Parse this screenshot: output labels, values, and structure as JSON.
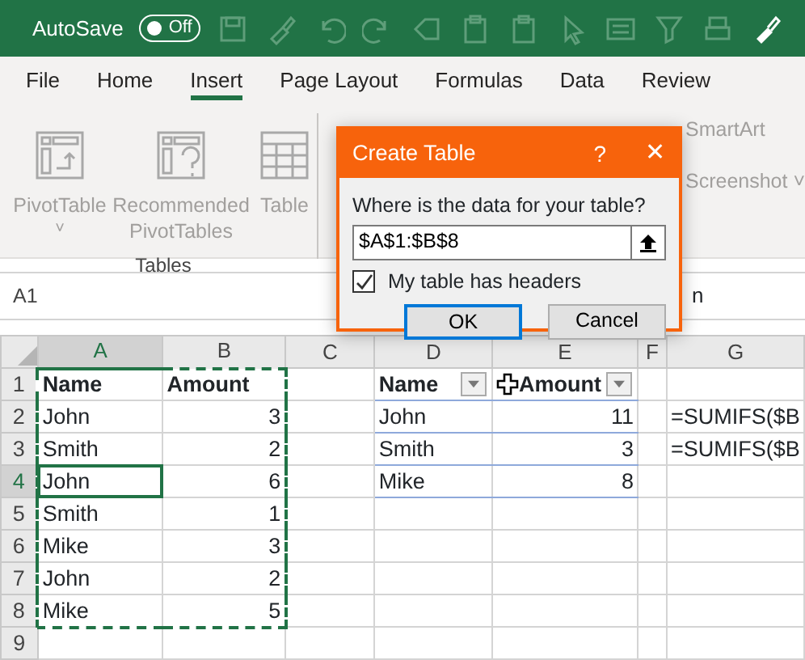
{
  "title_bar": {
    "autosave_label": "AutoSave",
    "autosave_toggle": {
      "label": "Off",
      "on": false
    }
  },
  "tabs": [
    {
      "label": "File",
      "selected": false
    },
    {
      "label": "Home",
      "selected": false
    },
    {
      "label": "Insert",
      "selected": true
    },
    {
      "label": "Page Layout",
      "selected": false
    },
    {
      "label": "Formulas",
      "selected": false
    },
    {
      "label": "Data",
      "selected": false
    },
    {
      "label": "Review",
      "selected": false
    }
  ],
  "ribbon": {
    "buttons": [
      {
        "kind": "pivot",
        "label": "PivotTable",
        "caret": "˅"
      },
      {
        "kind": "recommended",
        "label": "Recommended PivotTables"
      },
      {
        "kind": "table",
        "label": "Table"
      }
    ],
    "group_label": "Tables",
    "side_items": [
      {
        "label": "SmartArt"
      },
      {
        "label": "Screenshot",
        "caret": "˅"
      }
    ]
  },
  "formula_bar": {
    "name_box": "A1",
    "formula": "n"
  },
  "sheet": {
    "columns": [
      {
        "label": "A",
        "selected": true
      },
      {
        "label": "B",
        "selected": false
      },
      {
        "label": "C",
        "selected": false
      },
      {
        "label": "D",
        "selected": false
      },
      {
        "label": "E",
        "selected": false
      },
      {
        "label": "F",
        "selected": false
      },
      {
        "label": "G",
        "selected": false
      }
    ],
    "rows": [
      {
        "header": "1",
        "selected": false,
        "cells": [
          {
            "text": "Name",
            "kind": "text",
            "bold": true,
            "marquee": true,
            "active": false
          },
          {
            "text": "Amount",
            "kind": "text",
            "bold": true,
            "marquee": true,
            "active": false
          },
          "",
          {
            "text": "Name",
            "kind": "text",
            "bold": true,
            "table": true,
            "filter": true
          },
          {
            "text": "Amount",
            "kind": "text",
            "bold": true,
            "table": true,
            "filter": true,
            "cursor": true
          },
          "",
          ""
        ]
      },
      {
        "header": "2",
        "selected": false,
        "cells": [
          {
            "text": "John",
            "kind": "text",
            "bold": false,
            "marquee": true,
            "active": false
          },
          {
            "text": "3",
            "kind": "number",
            "bold": false,
            "marquee": true,
            "active": false
          },
          "",
          {
            "text": "John",
            "kind": "text",
            "bold": false,
            "table": true
          },
          {
            "text": "11",
            "kind": "number",
            "bold": false,
            "table": true
          },
          "",
          {
            "text": "=SUMIFS($B",
            "kind": "text",
            "bold": false
          }
        ]
      },
      {
        "header": "3",
        "selected": false,
        "cells": [
          {
            "text": "Smith",
            "kind": "text",
            "bold": false,
            "marquee": true,
            "active": false
          },
          {
            "text": "2",
            "kind": "number",
            "bold": false,
            "marquee": true,
            "active": false
          },
          "",
          {
            "text": "Smith",
            "kind": "text",
            "bold": false,
            "table": true
          },
          {
            "text": "3",
            "kind": "number",
            "bold": false,
            "table": true
          },
          "",
          {
            "text": "=SUMIFS($B",
            "kind": "text",
            "bold": false
          }
        ]
      },
      {
        "header": "4",
        "selected": true,
        "cells": [
          {
            "text": "John",
            "kind": "text",
            "bold": false,
            "marquee": true,
            "active": true
          },
          {
            "text": "6",
            "kind": "number",
            "bold": false,
            "marquee": true,
            "active": false
          },
          "",
          {
            "text": "Mike",
            "kind": "text",
            "bold": false,
            "table": true
          },
          {
            "text": "8",
            "kind": "number",
            "bold": false,
            "table": true
          },
          "",
          ""
        ]
      },
      {
        "header": "5",
        "selected": false,
        "cells": [
          {
            "text": "Smith",
            "kind": "text",
            "bold": false,
            "marquee": true,
            "active": false
          },
          {
            "text": "1",
            "kind": "number",
            "bold": false,
            "marquee": true,
            "active": false
          },
          "",
          "",
          "",
          "",
          ""
        ]
      },
      {
        "header": "6",
        "selected": false,
        "cells": [
          {
            "text": "Mike",
            "kind": "text",
            "bold": false,
            "marquee": true,
            "active": false
          },
          {
            "text": "3",
            "kind": "number",
            "bold": false,
            "marquee": true,
            "active": false
          },
          "",
          "",
          "",
          "",
          ""
        ]
      },
      {
        "header": "7",
        "selected": false,
        "cells": [
          {
            "text": "John",
            "kind": "text",
            "bold": false,
            "marquee": true,
            "active": false
          },
          {
            "text": "2",
            "kind": "number",
            "bold": false,
            "marquee": true,
            "active": false
          },
          "",
          "",
          "",
          "",
          ""
        ]
      },
      {
        "header": "8",
        "selected": false,
        "cells": [
          {
            "text": "Mike",
            "kind": "text",
            "bold": false,
            "marquee": true,
            "active": false
          },
          {
            "text": "5",
            "kind": "number",
            "bold": false,
            "marquee": true,
            "active": false
          },
          "",
          "",
          "",
          "",
          ""
        ]
      },
      {
        "header": "9",
        "selected": false,
        "cells": [
          "",
          "",
          "",
          "",
          "",
          "",
          ""
        ]
      }
    ]
  },
  "dialog": {
    "title": "Create Table",
    "help": "?",
    "close": "✕",
    "prompt": "Where is the data for your table?",
    "range": "$A$1:$B$8",
    "headers_checkbox": {
      "label": "My table has headers",
      "checked": true
    },
    "buttons": [
      {
        "label": "OK",
        "selected": true
      },
      {
        "label": "Cancel",
        "selected": false
      }
    ]
  }
}
